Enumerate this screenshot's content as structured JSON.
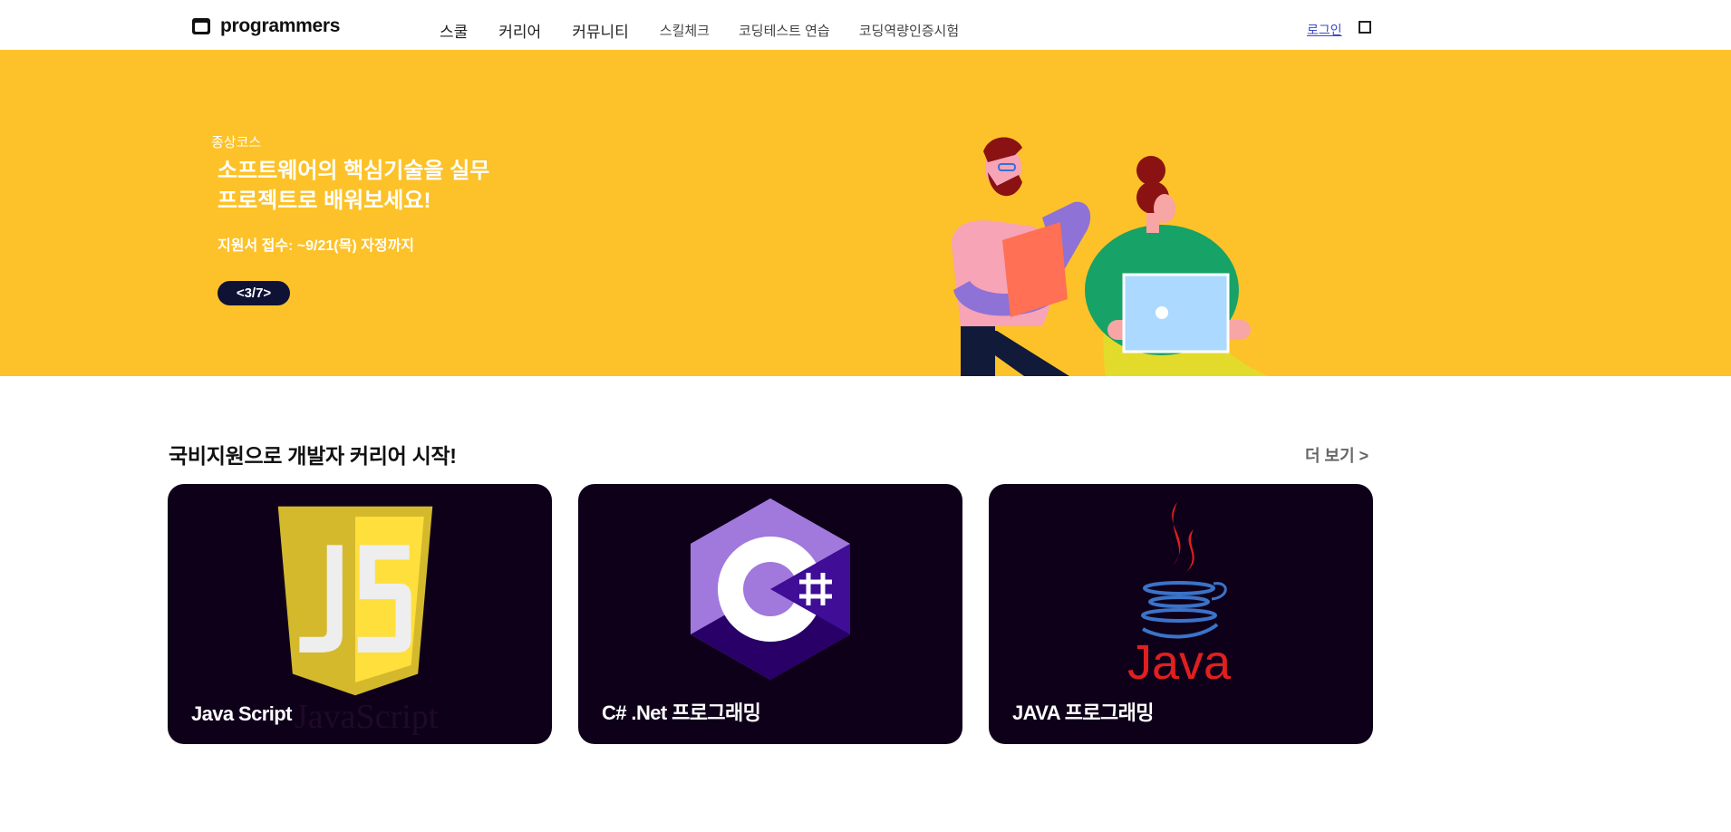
{
  "header": {
    "logo_text": "programmers",
    "nav_main": [
      "스쿨",
      "커리어",
      "커뮤니티"
    ],
    "nav_sub": [
      "스킬체크",
      "코딩테스트 연습",
      "코딩역량인증시험"
    ],
    "login_label": "로그인"
  },
  "banner": {
    "category": "종상코스",
    "title_line1": "소프트웨어의 핵심기술을 실무",
    "title_line2": "프로젝트로 배워보세요!",
    "description": "지원서 접수: ~9/21(목) 자정까지",
    "pager": "<3/7>",
    "background_color": "#fdc229"
  },
  "section": {
    "title": "국비지원으로 개발자 커리어 시작!",
    "more_label": "더 보기 >"
  },
  "cards": [
    {
      "label": "Java Script",
      "ghost_text": "JavaScript",
      "icon": "javascript-logo-icon"
    },
    {
      "label": "C# .Net 프로그래밍",
      "icon": "csharp-logo-icon"
    },
    {
      "label": "JAVA 프로그래밍",
      "icon": "java-logo-icon",
      "logo_text": "Java"
    }
  ]
}
